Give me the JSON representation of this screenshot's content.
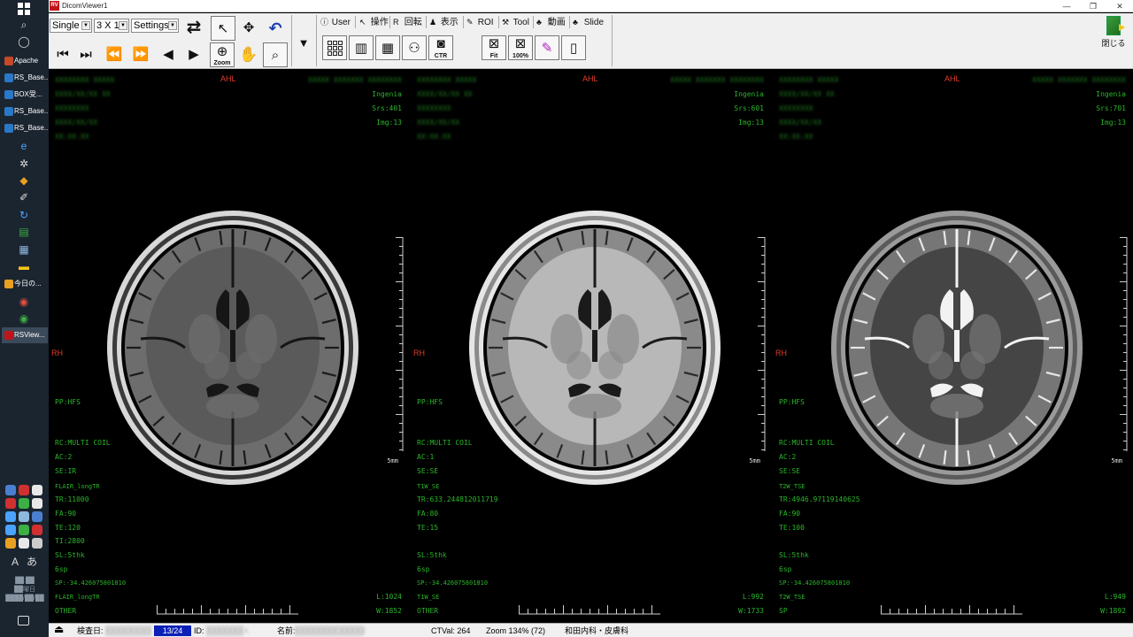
{
  "taskbar": {
    "apps": [
      {
        "label": "Apache",
        "color": "#c44a2a"
      },
      {
        "label": "RS_Base...",
        "color": "#2a78c8"
      },
      {
        "label": "BOX受...",
        "color": "#2a78c8"
      },
      {
        "label": "RS_Base...",
        "color": "#2a78c8"
      },
      {
        "label": "RS_Base...",
        "color": "#2a78c8"
      },
      {
        "label": "今日の...",
        "color": "#e8a020"
      },
      {
        "label": "RSView...",
        "color": "#c0141c"
      }
    ]
  },
  "window": {
    "icon_text": "RV",
    "title": "DicomViewer1",
    "min": "—",
    "restore": "❐",
    "close": "✕"
  },
  "toolbar": {
    "layout_mode": "Single",
    "grid_size": "3 X 1",
    "settings": "Settings",
    "zoom_label": "Zoom",
    "fit_label": "Fit",
    "pct_label": "100%",
    "ctr_label": "CTR",
    "close_label": "閉じる",
    "tabs": [
      {
        "icon": "ⓘ",
        "label": "User"
      },
      {
        "icon": "↖",
        "label": "操作"
      },
      {
        "icon": "R",
        "label": "回転"
      },
      {
        "icon": "♟",
        "label": "表示"
      },
      {
        "icon": "✎",
        "label": "ROI"
      },
      {
        "icon": "⚒",
        "label": "Tool"
      },
      {
        "icon": "♣",
        "label": "動画"
      },
      {
        "icon": "♣",
        "label": "Slide"
      }
    ]
  },
  "viewports": [
    {
      "orient_top": "AHL",
      "orient_left": "RH",
      "hdr_left": [
        "XXXXXXXX XXXXX",
        "XXXX/XX/XX  XX",
        "XXXXXXXX",
        "XXXX/XX/XX",
        "XX:XX:XX"
      ],
      "hdr_right_blur": "XXXXX XXXXXXX XXXXXXXX",
      "model": "Ingenia",
      "srs": "Srs:401",
      "img": "Img:13",
      "pp": "PP:HFS",
      "rc": "RC:MULTI COIL",
      "ac": "AC:2",
      "se": "SE:IR",
      "seq": "FLAIR_longTR",
      "tr": "TR:11000",
      "fa": "FA:90",
      "te": "TE:120",
      "ti": "TI:2800",
      "sl": "SL:5thk",
      "gap": "6sp",
      "sp": "SP:-34.426075801810",
      "seq2": "FLAIR_longTR",
      "other": "OTHER",
      "wl": "L:1024",
      "ww": "W:1852",
      "mm": "5mm"
    },
    {
      "orient_top": "AHL",
      "orient_left": "RH",
      "hdr_left": [
        "XXXXXXXX XXXXX",
        "XXXX/XX/XX  XX",
        "XXXXXXXX",
        "XXXX/XX/XX",
        "XX:XX:XX"
      ],
      "hdr_right_blur": "XXXXX XXXXXXX XXXXXXXX",
      "model": "Ingenia",
      "srs": "Srs:601",
      "img": "Img:13",
      "pp": "PP:HFS",
      "rc": "RC:MULTI COIL",
      "ac": "AC:1",
      "se": "SE:SE",
      "seq": "T1W_SE",
      "tr": "TR:633.244812011719",
      "fa": "FA:80",
      "te": "TE:15",
      "ti": "",
      "sl": "SL:5thk",
      "gap": "6sp",
      "sp": "SP:-34.426075801810",
      "seq2": "T1W_SE",
      "other": "OTHER",
      "wl": "L:992",
      "ww": "W:1733",
      "mm": "5mm"
    },
    {
      "orient_top": "AHL",
      "orient_left": "RH",
      "hdr_left": [
        "XXXXXXXX XXXXX",
        "XXXX/XX/XX  XX",
        "XXXXXXXX",
        "XXXX/XX/XX",
        "XX:XX:XX"
      ],
      "hdr_right_blur": "XXXXX XXXXXXX XXXXXXXX",
      "model": "Ingenia",
      "srs": "Srs:701",
      "img": "Img:13",
      "pp": "PP:HFS",
      "rc": "RC:MULTI COIL",
      "ac": "AC:2",
      "se": "SE:SE",
      "seq": "T2W_TSE",
      "tr": "TR:4946.97119140625",
      "fa": "FA:90",
      "te": "TE:100",
      "ti": "",
      "sl": "SL:5thk",
      "gap": "6sp",
      "sp": "SP:-34.426075801810",
      "seq2": "T2W_TSE",
      "other": "SP",
      "wl": "L:949",
      "ww": "W:1892",
      "mm": "5mm"
    }
  ],
  "statusbar": {
    "exam_date_label": "検査日:",
    "exam_date_value": "XXXX/XX/XX",
    "page": "13/24",
    "id_label": "ID:",
    "id_value": "XXXXXXXX",
    "name_label": "名前:",
    "name_value": "XXXXXXXX XXXXX",
    "ctval": "CTVal: 264",
    "zoom": "Zoom 134% (72)",
    "dept": "和田内科・皮膚科"
  }
}
